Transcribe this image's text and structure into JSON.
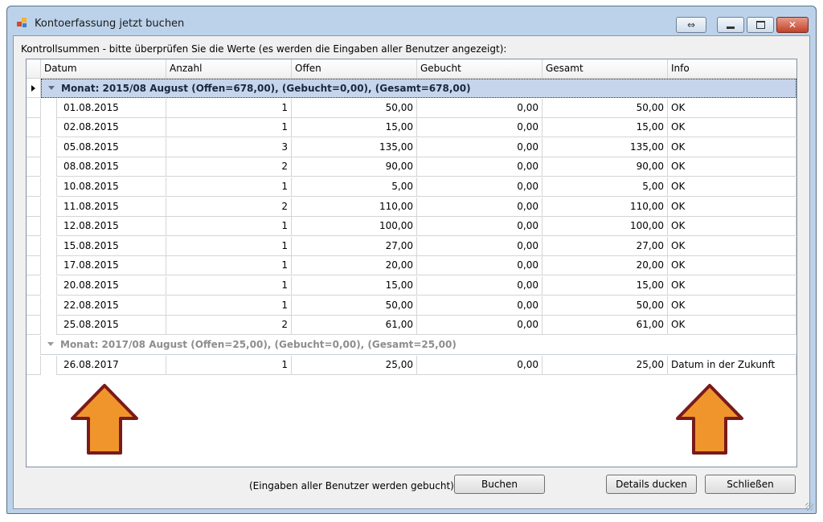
{
  "window": {
    "title": "Kontoerfassung jetzt buchen"
  },
  "hint": "Kontrollsummen - bitte überprüfen Sie die Werte (es werden die Eingaben aller Benutzer angezeigt):",
  "columns": [
    "Datum",
    "Anzahl",
    "Offen",
    "Gebucht",
    "Gesamt",
    "Info"
  ],
  "groups": [
    {
      "label": "Monat: 2015/08 August (Offen=678,00), (Gebucht=0,00), (Gesamt=678,00)",
      "rows": [
        [
          "01.08.2015",
          "1",
          "50,00",
          "0,00",
          "50,00",
          "OK"
        ],
        [
          "02.08.2015",
          "1",
          "15,00",
          "0,00",
          "15,00",
          "OK"
        ],
        [
          "05.08.2015",
          "3",
          "135,00",
          "0,00",
          "135,00",
          "OK"
        ],
        [
          "08.08.2015",
          "2",
          "90,00",
          "0,00",
          "90,00",
          "OK"
        ],
        [
          "10.08.2015",
          "1",
          "5,00",
          "0,00",
          "5,00",
          "OK"
        ],
        [
          "11.08.2015",
          "2",
          "110,00",
          "0,00",
          "110,00",
          "OK"
        ],
        [
          "12.08.2015",
          "1",
          "100,00",
          "0,00",
          "100,00",
          "OK"
        ],
        [
          "15.08.2015",
          "1",
          "27,00",
          "0,00",
          "27,00",
          "OK"
        ],
        [
          "17.08.2015",
          "1",
          "20,00",
          "0,00",
          "20,00",
          "OK"
        ],
        [
          "20.08.2015",
          "1",
          "15,00",
          "0,00",
          "15,00",
          "OK"
        ],
        [
          "22.08.2015",
          "1",
          "50,00",
          "0,00",
          "50,00",
          "OK"
        ],
        [
          "25.08.2015",
          "2",
          "61,00",
          "0,00",
          "61,00",
          "OK"
        ]
      ]
    },
    {
      "label": "Monat: 2017/08 August (Offen=25,00), (Gebucht=0,00), (Gesamt=25,00)",
      "rows": [
        [
          "26.08.2017",
          "1",
          "25,00",
          "0,00",
          "25,00",
          "Datum in der Zukunft"
        ]
      ]
    }
  ],
  "footer": {
    "note": "(Eingaben aller Benutzer werden gebucht)",
    "buchen": "Buchen",
    "details": "Details ducken",
    "close": "Schließen"
  },
  "icons": {
    "app": "app-icon",
    "restore_wide": "double-arrow-icon",
    "minimize": "minimize-icon",
    "maximize": "maximize-icon",
    "close": "close-icon",
    "annotation_arrow": "up-arrow-icon"
  },
  "colors": {
    "window_frame": "#bcd2ea",
    "group_highlight": "#c6d4ec",
    "arrow_fill": "#f0952b",
    "arrow_stroke": "#7a1a1a",
    "close_button": "#c3412a"
  }
}
